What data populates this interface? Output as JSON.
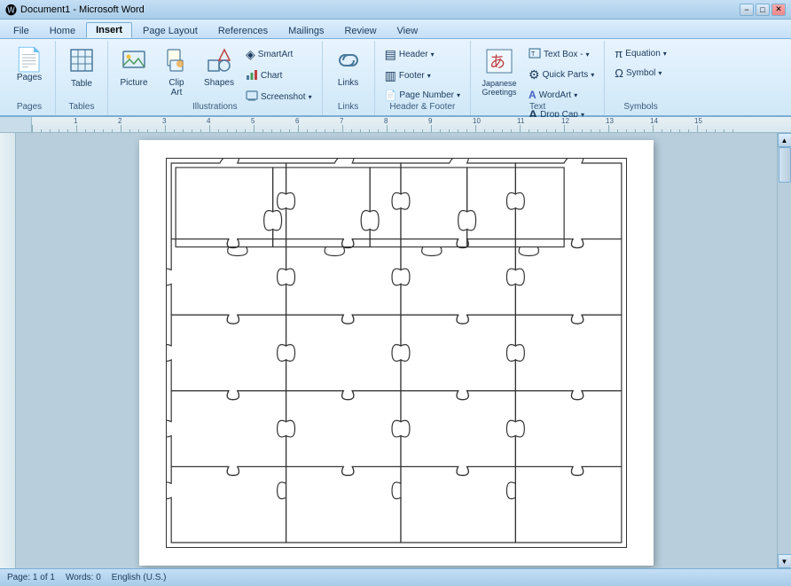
{
  "titleBar": {
    "title": "Document1 - Microsoft Word",
    "minimizeLabel": "−",
    "maximizeLabel": "□",
    "closeLabel": "✕"
  },
  "tabs": [
    {
      "id": "file",
      "label": "File"
    },
    {
      "id": "home",
      "label": "Home"
    },
    {
      "id": "insert",
      "label": "Insert",
      "active": true
    },
    {
      "id": "pagelayout",
      "label": "Page Layout"
    },
    {
      "id": "references",
      "label": "References"
    },
    {
      "id": "mailings",
      "label": "Mailings"
    },
    {
      "id": "review",
      "label": "Review"
    },
    {
      "id": "view",
      "label": "View"
    }
  ],
  "ribbon": {
    "groups": [
      {
        "id": "pages",
        "label": "Pages",
        "buttons": [
          {
            "id": "pages-btn",
            "label": "Pages",
            "icon": "📄",
            "large": true
          }
        ]
      },
      {
        "id": "tables",
        "label": "Tables",
        "buttons": [
          {
            "id": "table-btn",
            "label": "Table",
            "icon": "⊞",
            "large": true
          }
        ]
      },
      {
        "id": "illustrations",
        "label": "Illustrations",
        "buttons": [
          {
            "id": "picture-btn",
            "label": "Picture",
            "icon": "🖼",
            "large": true
          },
          {
            "id": "clip-art-btn",
            "label": "Clip Art",
            "icon": "✂",
            "large": true
          },
          {
            "id": "shapes-btn",
            "label": "Shapes",
            "icon": "◻",
            "large": true
          },
          {
            "id": "smartart-btn",
            "label": "SmartArt",
            "icon": "◈",
            "small": true
          },
          {
            "id": "chart-btn",
            "label": "Chart",
            "icon": "📊",
            "small": true
          },
          {
            "id": "screenshot-btn",
            "label": "Screenshot",
            "icon": "🖥",
            "small": true,
            "arrow": true
          }
        ]
      },
      {
        "id": "links",
        "label": "Links",
        "buttons": [
          {
            "id": "links-btn",
            "label": "Links",
            "icon": "🔗",
            "large": true
          }
        ]
      },
      {
        "id": "header-footer",
        "label": "Header & Footer",
        "buttons": [
          {
            "id": "header-btn",
            "label": "Header ▾",
            "icon": "▤",
            "small": true
          },
          {
            "id": "footer-btn",
            "label": "Footer ▾",
            "icon": "▥",
            "small": true
          },
          {
            "id": "page-number-btn",
            "label": "Page Number ▾",
            "icon": "#",
            "small": true
          }
        ]
      },
      {
        "id": "text-group",
        "label": "Text",
        "buttons": [
          {
            "id": "japanese-greetings-btn",
            "label": "Japanese Greetings",
            "icon": "あ",
            "large": true
          },
          {
            "id": "text-box-btn",
            "label": "Text Box ▾",
            "icon": "▭",
            "small": true
          },
          {
            "id": "quick-parts-btn",
            "label": "Quick Parts ▾",
            "icon": "⚙",
            "small": true
          },
          {
            "id": "wordart-btn",
            "label": "WordArt ▾",
            "icon": "A",
            "small": true
          },
          {
            "id": "drop-cap-btn",
            "label": "Drop Cap ▾",
            "icon": "A",
            "small": true
          }
        ]
      },
      {
        "id": "symbols",
        "label": "Symbols",
        "buttons": [
          {
            "id": "equation-btn",
            "label": "Equation ▾",
            "icon": "π",
            "small": true
          },
          {
            "id": "symbol-btn",
            "label": "Symbol ▾",
            "icon": "Ω",
            "small": true
          }
        ]
      }
    ]
  },
  "statusBar": {
    "page": "Page: 1 of 1",
    "words": "Words: 0",
    "language": "English (U.S.)"
  },
  "document": {
    "puzzle": "visible"
  },
  "icons": {
    "scrollUp": "▲",
    "scrollDown": "▼"
  }
}
